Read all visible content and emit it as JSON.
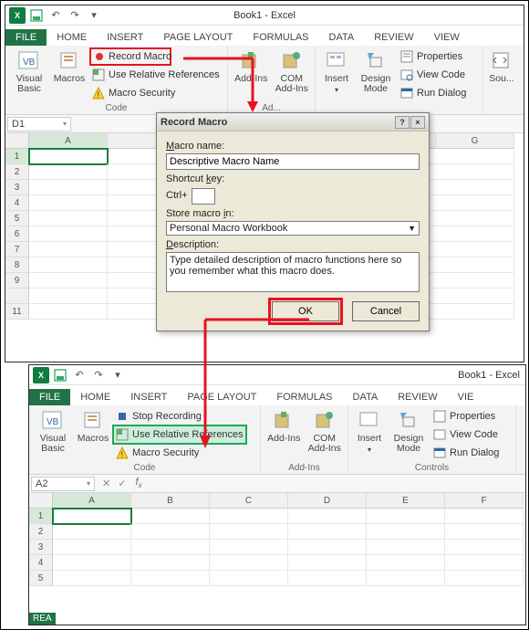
{
  "upper": {
    "book_title": "Book1 - Excel",
    "tabs": [
      "FILE",
      "HOME",
      "INSERT",
      "PAGE LAYOUT",
      "FORMULAS",
      "DATA",
      "REVIEW",
      "VIEW"
    ],
    "code_group": {
      "visual_basic": "Visual\nBasic",
      "macros": "Macros",
      "record_macro": "Record Macro",
      "use_relative": "Use Relative References",
      "macro_security": "Macro Security",
      "label": "Code"
    },
    "addins_group": {
      "addins": "Add-Ins",
      "com": "COM\nAdd-Ins",
      "label": "Ad..."
    },
    "controls_group": {
      "insert": "Insert",
      "design": "Design\nMode",
      "properties": "Properties",
      "view_code": "View Code",
      "run_dialog": "Run Dialog",
      "label": ""
    },
    "sou_btn": "Sou...",
    "namebox": "D1",
    "cols": [
      "A",
      "",
      "",
      "",
      "",
      "",
      "G"
    ],
    "rows": [
      "1",
      "2",
      "3",
      "4",
      "5",
      "6",
      "7",
      "8",
      "9",
      "",
      "11"
    ]
  },
  "dialog": {
    "title": "Record Macro",
    "macro_name_label": "Macro name:",
    "macro_name_value": "Descriptive Macro Name",
    "shortcut_label": "Shortcut key:",
    "ctrl": "Ctrl+",
    "store_label": "Store macro in:",
    "store_value": "Personal Macro Workbook",
    "desc_label": "Description:",
    "desc_value": "Type detailed description of macro functions here so you remember what this macro does.",
    "ok": "OK",
    "cancel": "Cancel"
  },
  "lower": {
    "book_title": "Book1 - Excel",
    "tabs": [
      "FILE",
      "HOME",
      "INSERT",
      "PAGE LAYOUT",
      "FORMULAS",
      "DATA",
      "REVIEW",
      "VIE"
    ],
    "code_group": {
      "visual_basic": "Visual\nBasic",
      "macros": "Macros",
      "stop_recording": "Stop Recording",
      "use_relative": "Use Relative References",
      "macro_security": "Macro Security",
      "label": "Code"
    },
    "addins_group": {
      "addins": "Add-Ins",
      "com": "COM\nAdd-Ins",
      "label": "Add-Ins"
    },
    "controls_group": {
      "insert": "Insert",
      "design": "Design\nMode",
      "properties": "Properties",
      "view_code": "View Code",
      "run_dialog": "Run Dialog",
      "label": "Controls"
    },
    "namebox": "A2",
    "cols": [
      "A",
      "B",
      "C",
      "D",
      "E",
      "F"
    ],
    "rows": [
      "1",
      "2",
      "3",
      "4",
      "5"
    ],
    "status": "REA"
  },
  "chart_data": null
}
